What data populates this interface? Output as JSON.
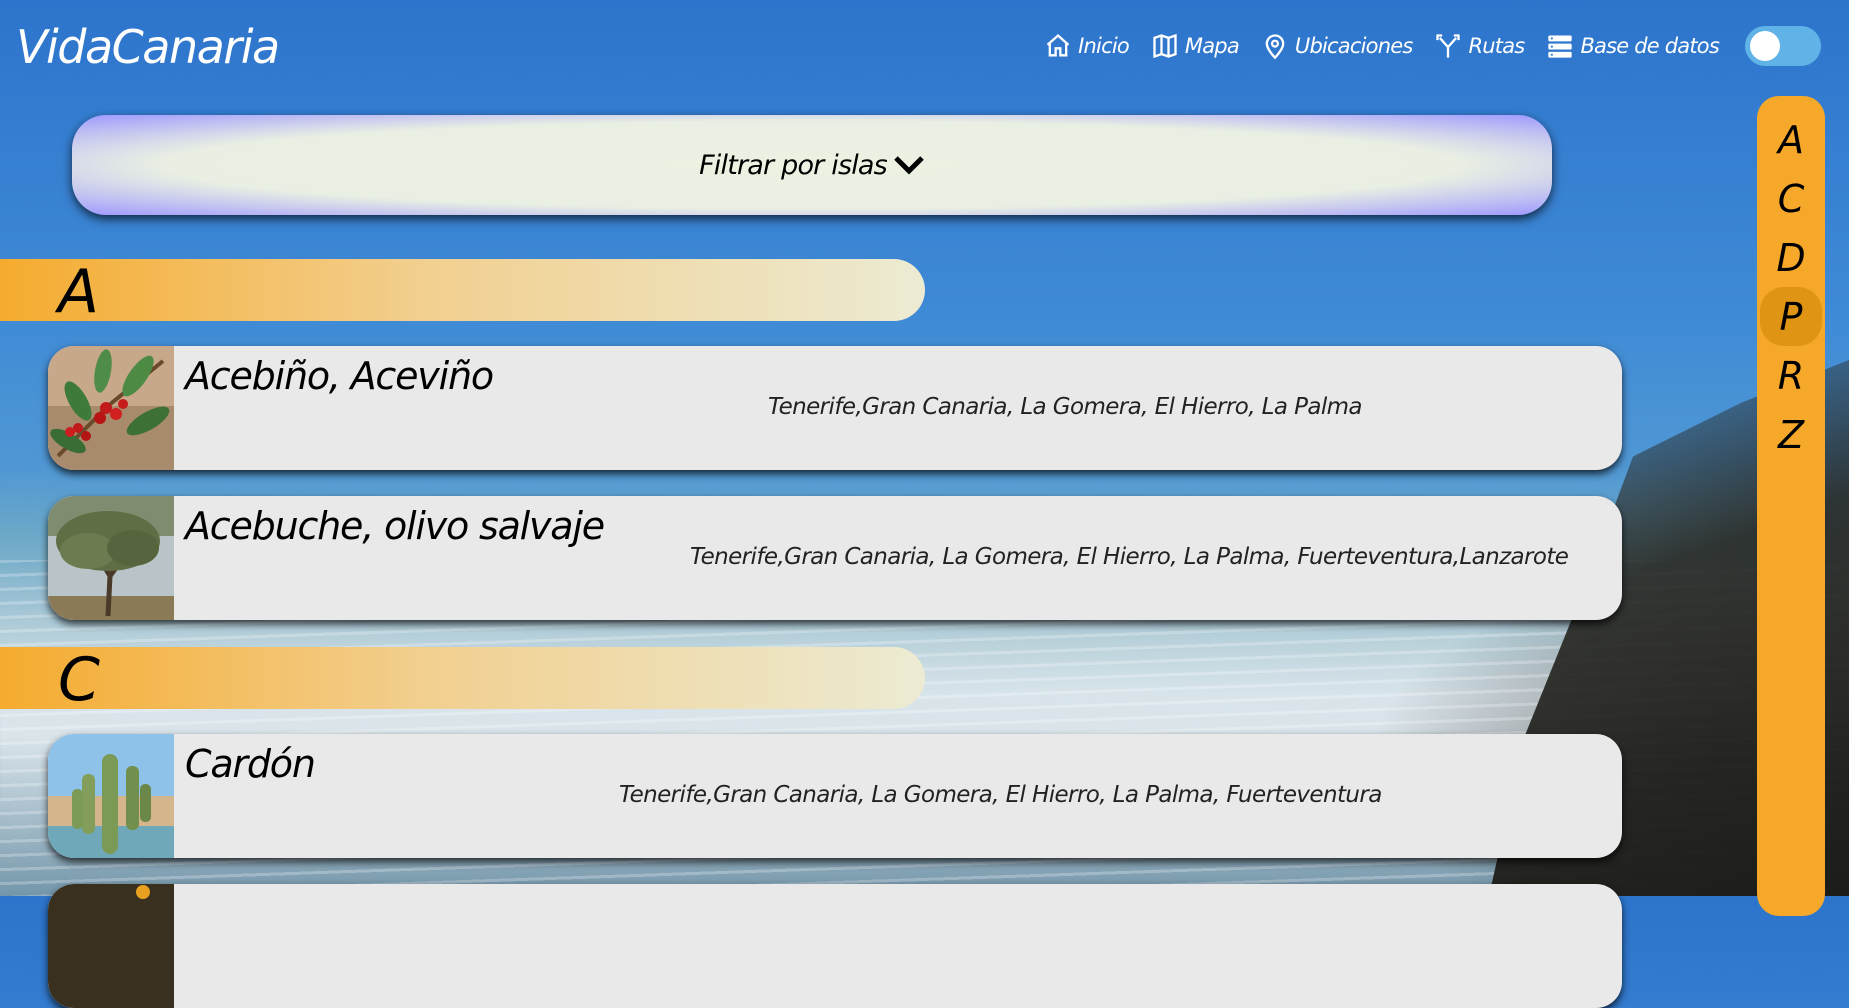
{
  "brand": "VidaCanaria",
  "nav": [
    {
      "label": "Inicio",
      "icon": "home-icon"
    },
    {
      "label": "Mapa",
      "icon": "map-icon"
    },
    {
      "label": "Ubicaciones",
      "icon": "location-pin-icon"
    },
    {
      "label": "Rutas",
      "icon": "route-fork-icon"
    },
    {
      "label": "Base de datos",
      "icon": "database-icon"
    }
  ],
  "theme_toggle": {
    "state": "off"
  },
  "filter": {
    "label": "Filtrar por islas",
    "icon": "chevron-down-icon"
  },
  "sections": [
    {
      "letter": "A",
      "items": [
        {
          "name": "Acebiño, Aceviño",
          "islands": "Tenerife,Gran Canaria, La Gomera, El Hierro, La Palma",
          "image": "holly-berries"
        },
        {
          "name": "Acebuche, olivo salvaje",
          "islands": "Tenerife,Gran Canaria, La Gomera, El Hierro, La Palma, Fuerteventura,Lanzarote",
          "image": "wild-olive-tree"
        }
      ]
    },
    {
      "letter": "C",
      "items": [
        {
          "name": "Cardón",
          "islands": "Tenerife,Gran Canaria, La Gomera, El Hierro, La Palma, Fuerteventura",
          "image": "cardon-cactus"
        }
      ]
    }
  ],
  "alphabet_index": [
    "A",
    "C",
    "D",
    "P",
    "R",
    "Z"
  ],
  "alphabet_active": "P",
  "colors": {
    "accent": "#f5a829",
    "card": "#e9e9e9",
    "toggle": "#5fb3e6",
    "filter_edge": "#9d98ff"
  }
}
